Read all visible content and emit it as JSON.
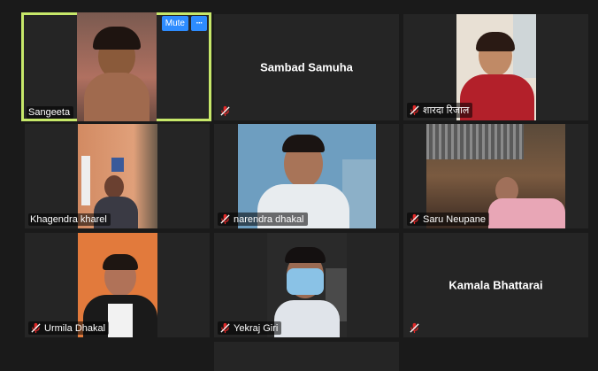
{
  "participants": [
    {
      "name": "Sangeeta",
      "video": true,
      "active": true
    },
    {
      "name": "Sambad Samuha",
      "video": false
    },
    {
      "name": "शारदा रिजाल",
      "video": true
    },
    {
      "name": "Khagendra kharel",
      "video": true
    },
    {
      "name": "narendra dhakal",
      "video": true
    },
    {
      "name": "Saru Neupane",
      "video": true
    },
    {
      "name": "Urmila Dhakal",
      "video": true
    },
    {
      "name": "Yekraj Giri",
      "video": true
    },
    {
      "name": "Kamala Bhattarai",
      "video": false
    }
  ],
  "hover": {
    "mute_label": "Mute",
    "more_label": "···"
  },
  "icons": {
    "muted": "mic-muted-icon",
    "more": "more-icon"
  },
  "colors": {
    "active_border": "#c7e86a",
    "button": "#2d8cff",
    "muted_mic": "#e02828"
  }
}
